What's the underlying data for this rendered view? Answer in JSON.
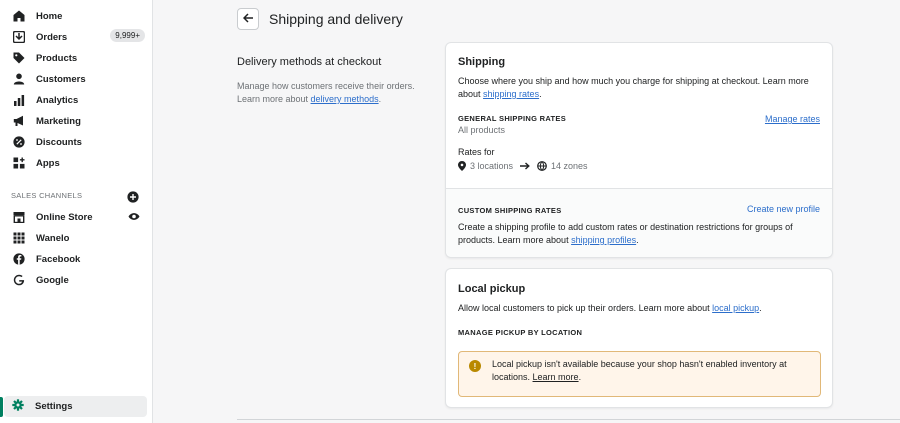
{
  "sidebar": {
    "items": [
      {
        "label": "Home",
        "icon": "home-icon"
      },
      {
        "label": "Orders",
        "icon": "orders-icon",
        "badge": "9,999+"
      },
      {
        "label": "Products",
        "icon": "tag-icon"
      },
      {
        "label": "Customers",
        "icon": "person-icon"
      },
      {
        "label": "Analytics",
        "icon": "bar-chart-icon"
      },
      {
        "label": "Marketing",
        "icon": "megaphone-icon"
      },
      {
        "label": "Discounts",
        "icon": "discount-icon"
      },
      {
        "label": "Apps",
        "icon": "apps-icon"
      }
    ],
    "sales_channels_heading": "SALES CHANNELS",
    "channels": [
      {
        "label": "Online Store",
        "icon": "store-icon"
      },
      {
        "label": "Wanelo",
        "icon": "grid-icon"
      },
      {
        "label": "Facebook",
        "icon": "facebook-icon"
      },
      {
        "label": "Google",
        "icon": "google-icon"
      }
    ],
    "settings_label": "Settings"
  },
  "header": {
    "title": "Shipping and delivery"
  },
  "annotation": {
    "title": "Delivery methods at checkout",
    "desc": "Manage how customers receive their orders. Learn more about ",
    "link": "delivery methods",
    "end": "."
  },
  "shipping": {
    "title": "Shipping",
    "desc": "Choose where you ship and how much you charge for shipping at checkout. Learn more about ",
    "desc_link": "shipping rates",
    "desc_end": ".",
    "general_heading": "GENERAL SHIPPING RATES",
    "all_products": "All products",
    "manage_rates": "Manage rates",
    "rates_for": "Rates for",
    "locations": "3 locations",
    "zones": "14 zones",
    "custom_heading": "CUSTOM SHIPPING RATES",
    "create_profile": "Create new profile",
    "custom_desc": "Create a shipping profile to add custom rates or destination restrictions for groups of products. Learn more about ",
    "custom_link": "shipping profiles",
    "custom_end": "."
  },
  "pickup": {
    "title": "Local pickup",
    "desc": "Allow local customers to pick up their orders. Learn more about ",
    "desc_link": "local pickup",
    "desc_end": ".",
    "manage_heading": "MANAGE PICKUP BY LOCATION",
    "warning": "Local pickup isn't available because your shop hasn't enabled inventory at locations. ",
    "warning_link": "Learn more",
    "warning_end": "."
  },
  "colors": {
    "accent": "#008060",
    "link": "#2c6ecb",
    "warning_bg": "#fff5ea",
    "warning_icon": "#b98900"
  }
}
